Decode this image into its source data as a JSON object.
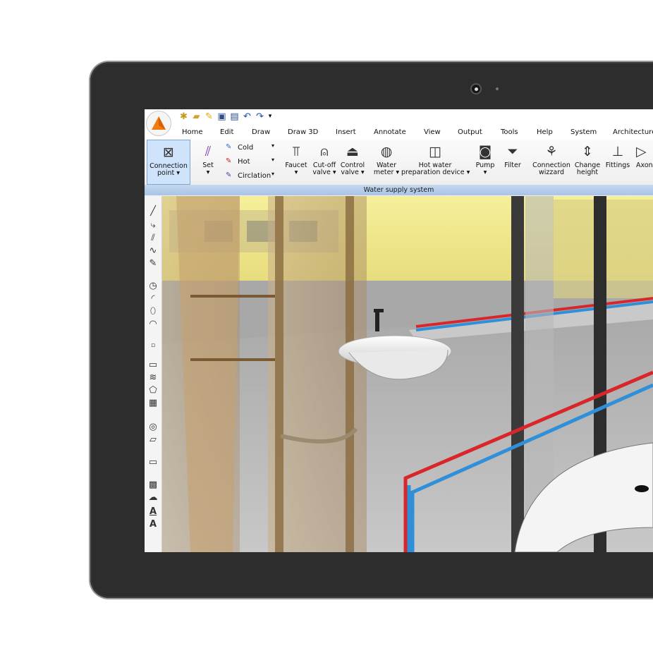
{
  "quick_access": [
    "new-file-icon",
    "open-folder-icon",
    "edit-icon",
    "save-icon",
    "print-icon",
    "undo-icon",
    "redo-icon",
    "dropdown-icon"
  ],
  "menu": [
    "Home",
    "Edit",
    "Draw",
    "Draw 3D",
    "Insert",
    "Annotate",
    "View",
    "Output",
    "Tools",
    "Help",
    "System",
    "Architecture"
  ],
  "ribbon": {
    "connection_point": [
      "Connection",
      "point ▾"
    ],
    "set": [
      "Set",
      "▾"
    ],
    "cold": "Cold",
    "hot": "Hot",
    "circulation": "Circlation",
    "faucet": [
      "Faucet",
      "▾"
    ],
    "cutoff": [
      "Cut-off",
      "valve ▾"
    ],
    "control": [
      "Control",
      "valve ▾"
    ],
    "water_meter": [
      "Water",
      "meter ▾"
    ],
    "hot_water": [
      "Hot water",
      "preparation device ▾"
    ],
    "pump": [
      "Pump",
      "▾"
    ],
    "filter": "Filter",
    "connection_wizard": [
      "Connection",
      "wizzard"
    ],
    "change_height": [
      "Change",
      "height"
    ],
    "fittings": "Fittings",
    "axon": "Axon",
    "group_label": "Water supply system"
  },
  "colors": {
    "hot_pipe": "#d8262b",
    "cold_pipe": "#2f8fd8",
    "accent": "#f07c0f",
    "ribbon_group": "#b3cbe9"
  }
}
